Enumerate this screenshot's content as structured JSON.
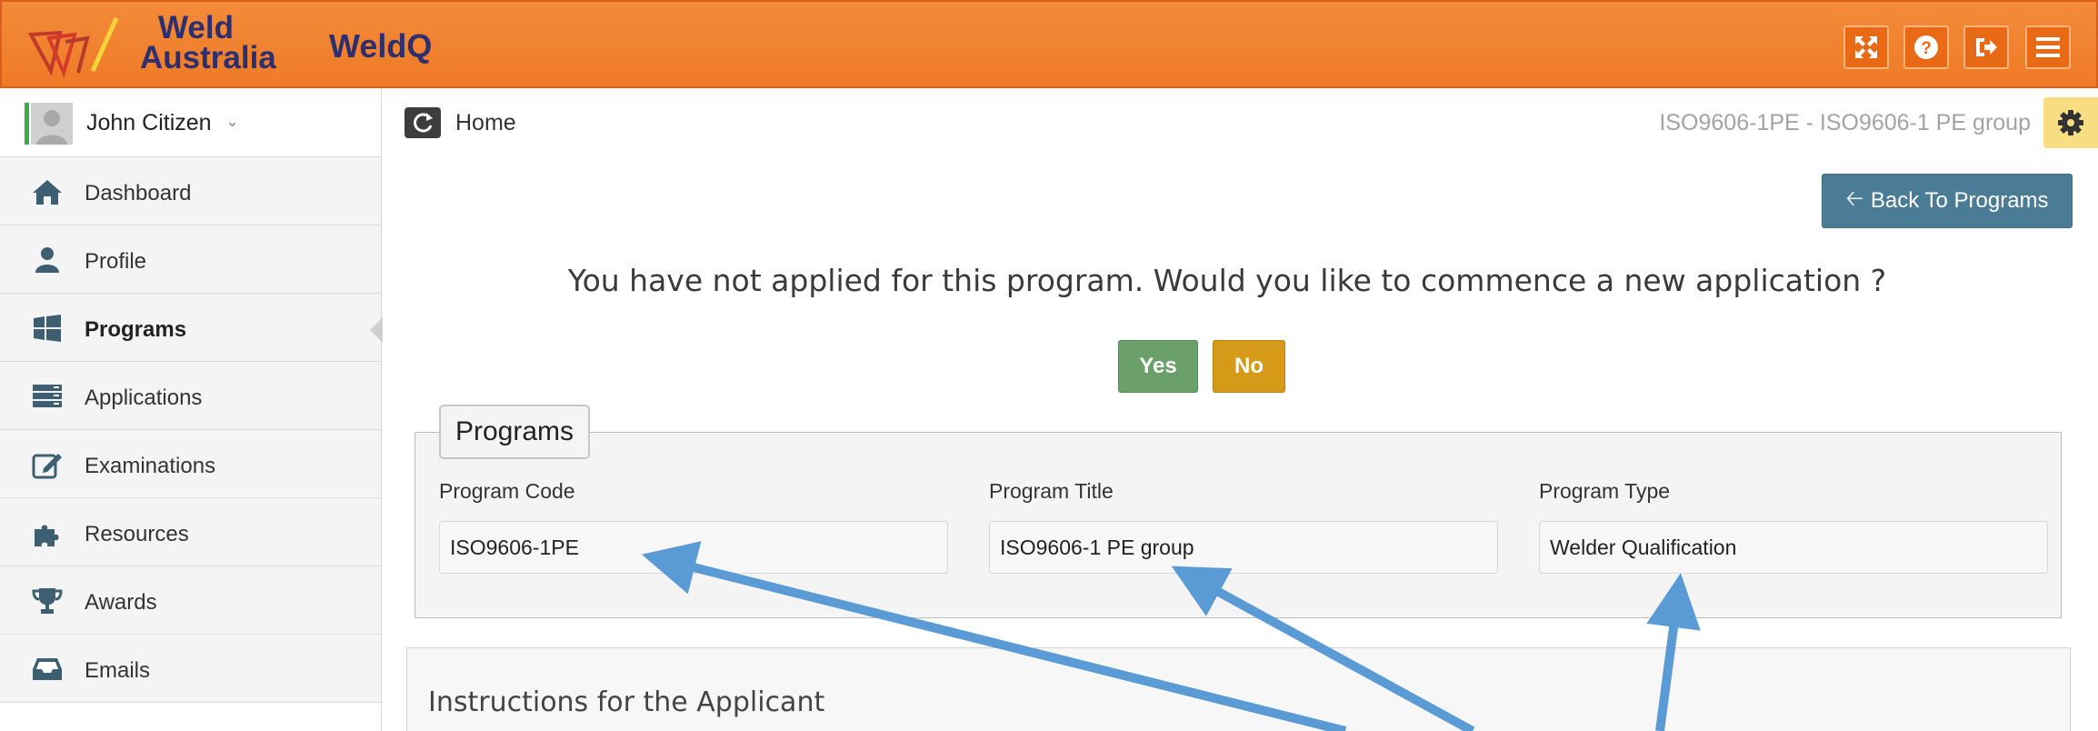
{
  "header": {
    "brand_line1": "Weld",
    "brand_line2": "Australia",
    "app_name": "WeldQ",
    "icons": [
      "fullscreen-icon",
      "help-icon",
      "logout-icon",
      "menu-icon"
    ]
  },
  "sidebar": {
    "user_name": "John Citizen",
    "items": [
      {
        "label": "Dashboard",
        "icon": "home-icon"
      },
      {
        "label": "Profile",
        "icon": "user-icon"
      },
      {
        "label": "Programs",
        "icon": "windows-icon",
        "active": true
      },
      {
        "label": "Applications",
        "icon": "server-icon"
      },
      {
        "label": "Examinations",
        "icon": "edit-icon"
      },
      {
        "label": "Resources",
        "icon": "puzzle-icon"
      },
      {
        "label": "Awards",
        "icon": "trophy-icon"
      },
      {
        "label": "Emails",
        "icon": "inbox-icon"
      }
    ]
  },
  "main": {
    "breadcrumb": "Home",
    "program_heading": "ISO9606-1PE - ISO9606-1 PE group",
    "back_button": "Back To Programs",
    "question": "You have not applied for this program. Would you like to commence a new application ?",
    "yes_label": "Yes",
    "no_label": "No",
    "fieldset_legend": "Programs",
    "fields": {
      "code_label": "Program Code",
      "code_value": "ISO9606-1PE",
      "title_label": "Program Title",
      "title_value": "ISO9606-1 PE group",
      "type_label": "Program Type",
      "type_value": "Welder Qualification"
    },
    "instructions_title": "Instructions for the Applicant"
  },
  "colors": {
    "header": "#ef7a26",
    "brand": "#2d2f6e",
    "back_button": "#4a7d95",
    "yes_button": "#6ca06a",
    "no_button": "#d49a18",
    "annotation_arrow": "#5b9bd5"
  }
}
